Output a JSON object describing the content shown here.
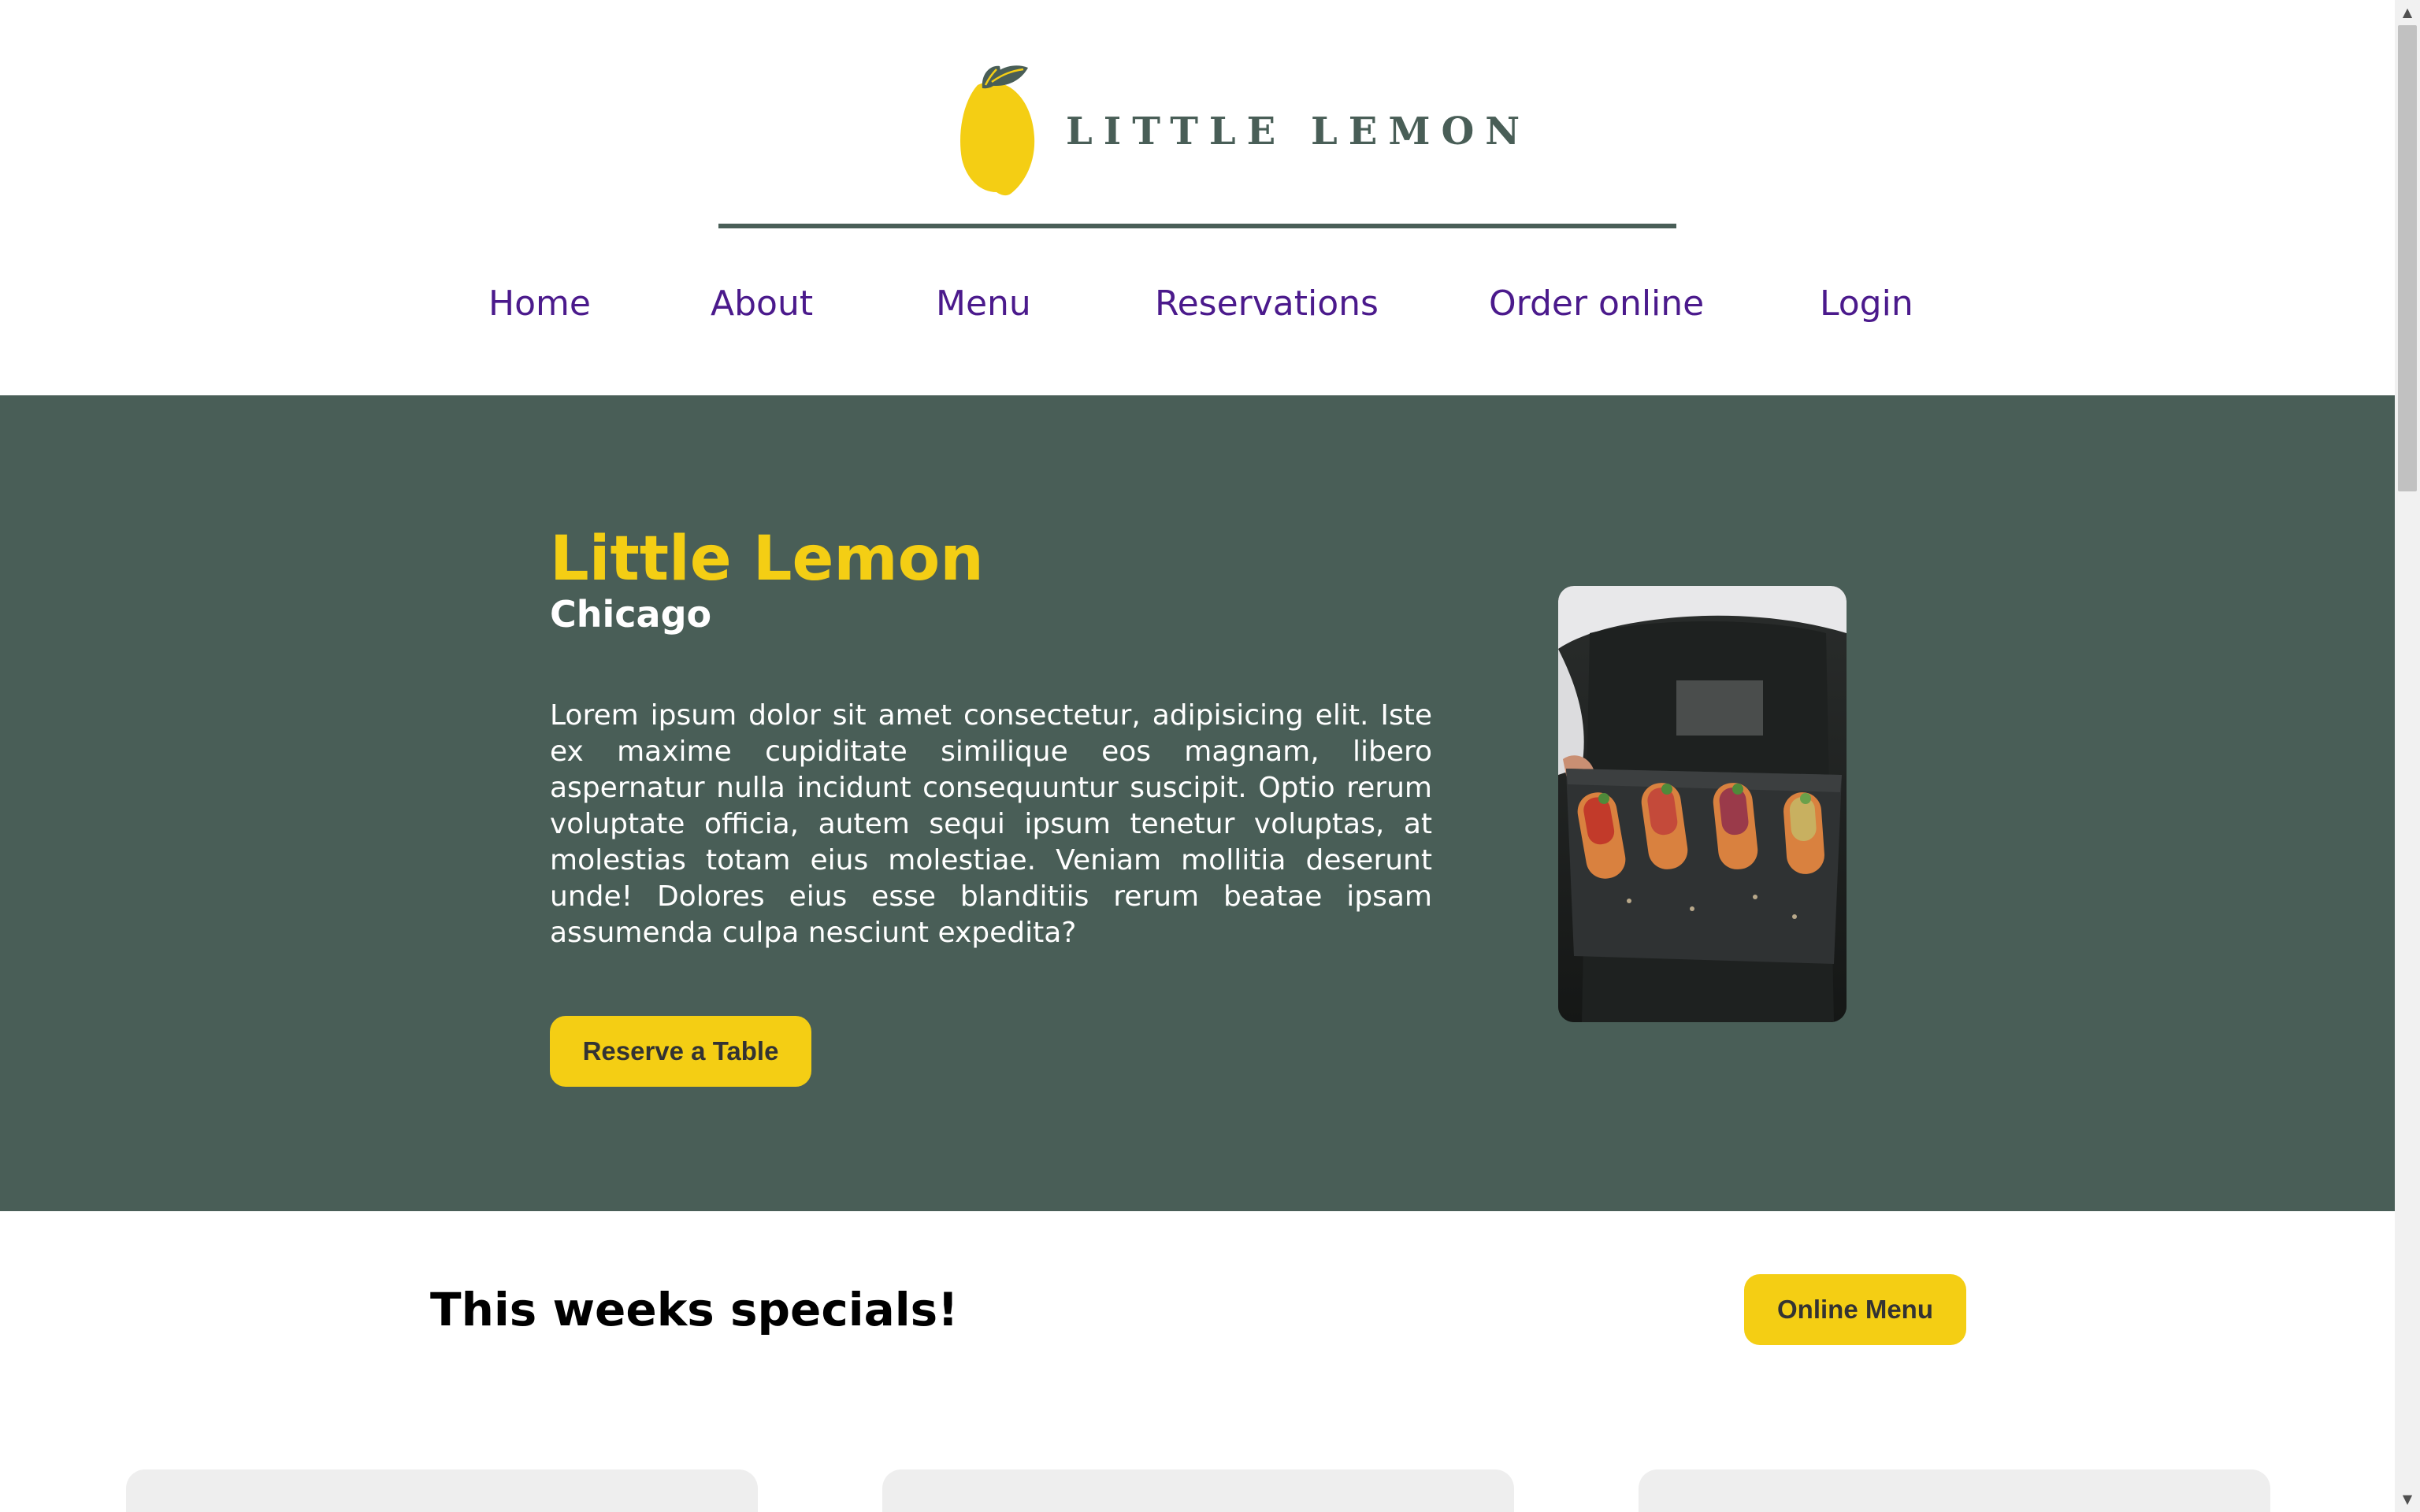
{
  "header": {
    "brand_name": "LITTLE LEMON",
    "logo_icon": "lemon-icon"
  },
  "nav": {
    "items": [
      {
        "label": "Home"
      },
      {
        "label": "About"
      },
      {
        "label": "Menu"
      },
      {
        "label": "Reservations"
      },
      {
        "label": "Order online"
      },
      {
        "label": "Login"
      }
    ]
  },
  "hero": {
    "title": "Little Lemon",
    "subtitle": "Chicago",
    "description": "Lorem ipsum dolor sit amet consectetur, adipisicing elit. Iste ex maxime cupiditate similique eos magnam, libero aspernatur nulla incidunt consequuntur suscipit. Optio rerum voluptate officia, autem sequi ipsum tenetur voluptas, at molestias totam eius molestiae. Veniam mollitia deserunt unde! Dolores eius esse blanditiis rerum beatae ipsam assumenda culpa nesciunt expedita?",
    "cta_label": "Reserve a Table",
    "image": "restaurant-food-photo"
  },
  "specials": {
    "title": "This weeks specials!",
    "button_label": "Online Menu"
  },
  "colors": {
    "primary_green": "#495e57",
    "primary_yellow": "#f4ce14",
    "nav_link": "#4b1a8c",
    "card_bg": "#eeeeee"
  }
}
